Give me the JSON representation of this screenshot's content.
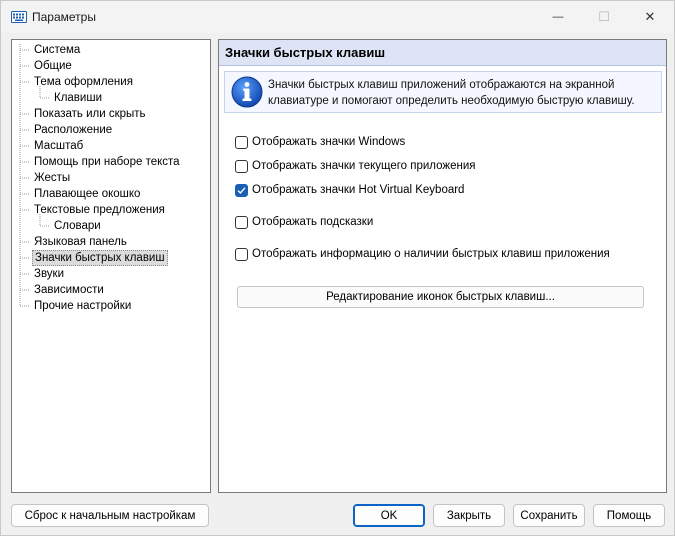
{
  "window": {
    "title": "Параметры",
    "minimize_glyph": "—",
    "maximize_glyph": "☐",
    "close_glyph": "✕"
  },
  "tree": {
    "items": [
      {
        "label": "Система",
        "level": 0
      },
      {
        "label": "Общие",
        "level": 0
      },
      {
        "label": "Тема оформления",
        "level": 0
      },
      {
        "label": "Клавиши",
        "level": 1
      },
      {
        "label": "Показать или скрыть",
        "level": 0
      },
      {
        "label": "Расположение",
        "level": 0
      },
      {
        "label": "Масштаб",
        "level": 0
      },
      {
        "label": "Помощь при наборе текста",
        "level": 0
      },
      {
        "label": "Жесты",
        "level": 0
      },
      {
        "label": "Плавающее окошко",
        "level": 0
      },
      {
        "label": "Текстовые предложения",
        "level": 0
      },
      {
        "label": "Словари",
        "level": 1
      },
      {
        "label": "Языковая панель",
        "level": 0
      },
      {
        "label": "Значки быстрых клавиш",
        "level": 0,
        "selected": true
      },
      {
        "label": "Звуки",
        "level": 0
      },
      {
        "label": "Зависимости",
        "level": 0
      },
      {
        "label": "Прочие настройки",
        "level": 0
      }
    ]
  },
  "content": {
    "title": "Значки быстрых клавиш",
    "info_line1": "Значки быстрых клавиш приложений отображаются на экранной",
    "info_line2": "клавиатуре и помогают определить необходимую быструю клавишу.",
    "checkboxes": [
      {
        "label": "Отображать значки Windows",
        "checked": false
      },
      {
        "label": "Отображать значки текущего приложения",
        "checked": false
      },
      {
        "label": "Отображать значки Hot Virtual Keyboard",
        "checked": true
      },
      {
        "label": "Отображать подсказки",
        "checked": false
      },
      {
        "label": "Отображать информацию о наличии быстрых клавиш приложения",
        "checked": false
      }
    ],
    "edit_button": "Редактирование иконок быстрых клавиш..."
  },
  "buttons": {
    "reset": "Сброс к начальным настройкам",
    "ok": "OK",
    "close": "Закрыть",
    "save": "Сохранить",
    "help": "Помощь"
  },
  "colors": {
    "accent": "#1a5fb4",
    "header_bg": "#dde4f5"
  }
}
